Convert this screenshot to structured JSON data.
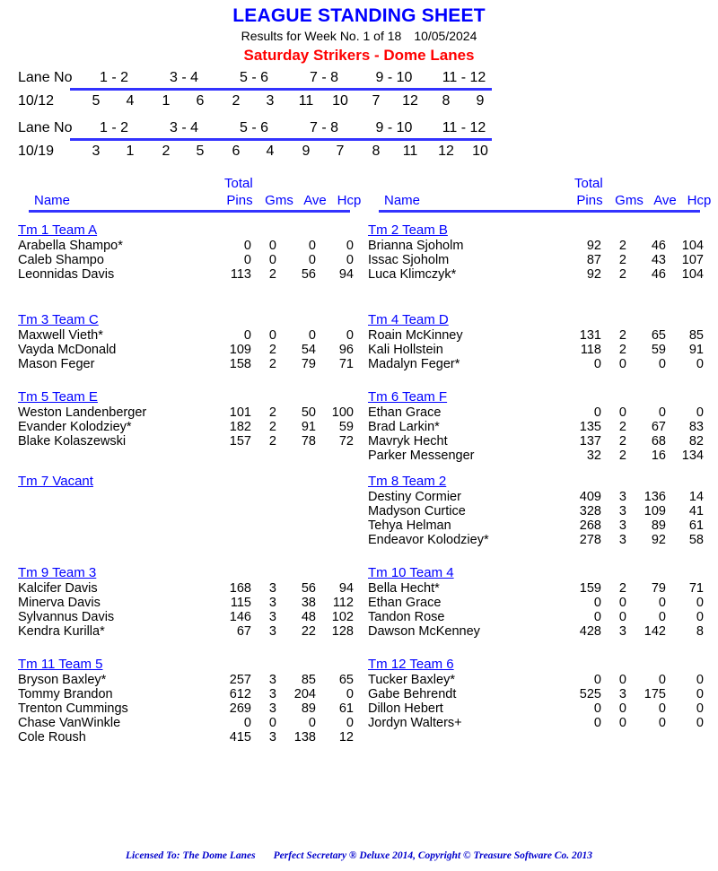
{
  "colors": {
    "title_blue": "#0000ff",
    "league_red": "#ff0000",
    "rule_blue": "#3333ff",
    "footer_blue": "#0000cc",
    "text_black": "#000000"
  },
  "header": {
    "title": "LEAGUE STANDING SHEET",
    "results_prefix": "Results for Week No. 1 of 18",
    "results_date": "10/05/2024",
    "league_name": "Saturday Strikers - Dome Lanes"
  },
  "lane_schedule": {
    "label": "Lane No",
    "pair_headers": [
      "1 - 2",
      "3 - 4",
      "5 - 6",
      "7 - 8",
      "9 - 10",
      "11 - 12"
    ],
    "weeks": [
      {
        "date": "10/12",
        "pairs": [
          [
            "5",
            "4"
          ],
          [
            "1",
            "6"
          ],
          [
            "2",
            "3"
          ],
          [
            "11",
            "10"
          ],
          [
            "7",
            "12"
          ],
          [
            "8",
            "9"
          ]
        ]
      },
      {
        "date": "10/19",
        "pairs": [
          [
            "3",
            "1"
          ],
          [
            "2",
            "5"
          ],
          [
            "6",
            "4"
          ],
          [
            "9",
            "7"
          ],
          [
            "8",
            "11"
          ],
          [
            "12",
            "10"
          ]
        ]
      }
    ]
  },
  "table_header": {
    "name": "Name",
    "total": "Total",
    "pins": "Pins",
    "gms": "Gms",
    "ave": "Ave",
    "hcp": "Hcp"
  },
  "columns": {
    "left": [
      {
        "team": "Tm 1 Team A",
        "players": [
          {
            "name": "Arabella Shampo*",
            "pins": "0",
            "gms": "0",
            "ave": "0",
            "hcp": "0"
          },
          {
            "name": "Caleb Shampo",
            "pins": "0",
            "gms": "0",
            "ave": "0",
            "hcp": "0"
          },
          {
            "name": "Leonnidas Davis",
            "pins": "113",
            "gms": "2",
            "ave": "56",
            "hcp": "94"
          }
        ]
      },
      {
        "team": "Tm 3 Team C",
        "players": [
          {
            "name": "Maxwell Vieth*",
            "pins": "0",
            "gms": "0",
            "ave": "0",
            "hcp": "0"
          },
          {
            "name": "Vayda McDonald",
            "pins": "109",
            "gms": "2",
            "ave": "54",
            "hcp": "96"
          },
          {
            "name": "Mason Feger",
            "pins": "158",
            "gms": "2",
            "ave": "79",
            "hcp": "71"
          }
        ]
      },
      {
        "team": "Tm 5 Team E",
        "players": [
          {
            "name": "Weston Landenberger",
            "pins": "101",
            "gms": "2",
            "ave": "50",
            "hcp": "100"
          },
          {
            "name": "Evander Kolodziey*",
            "pins": "182",
            "gms": "2",
            "ave": "91",
            "hcp": "59"
          },
          {
            "name": "Blake Kolaszewski",
            "pins": "157",
            "gms": "2",
            "ave": "78",
            "hcp": "72"
          }
        ]
      },
      {
        "team": "Tm 7 Vacant",
        "players": []
      },
      {
        "team": "Tm 9 Team 3",
        "players": [
          {
            "name": "Kalcifer Davis",
            "pins": "168",
            "gms": "3",
            "ave": "56",
            "hcp": "94"
          },
          {
            "name": "Minerva Davis",
            "pins": "115",
            "gms": "3",
            "ave": "38",
            "hcp": "112"
          },
          {
            "name": "Sylvannus Davis",
            "pins": "146",
            "gms": "3",
            "ave": "48",
            "hcp": "102"
          },
          {
            "name": "Kendra Kurilla*",
            "pins": "67",
            "gms": "3",
            "ave": "22",
            "hcp": "128"
          }
        ]
      },
      {
        "team": "Tm 11 Team 5",
        "players": [
          {
            "name": "Bryson Baxley*",
            "pins": "257",
            "gms": "3",
            "ave": "85",
            "hcp": "65"
          },
          {
            "name": "Tommy Brandon",
            "pins": "612",
            "gms": "3",
            "ave": "204",
            "hcp": "0"
          },
          {
            "name": "Trenton Cummings",
            "pins": "269",
            "gms": "3",
            "ave": "89",
            "hcp": "61"
          },
          {
            "name": "Chase VanWinkle",
            "pins": "0",
            "gms": "0",
            "ave": "0",
            "hcp": "0"
          },
          {
            "name": "Cole Roush",
            "pins": "415",
            "gms": "3",
            "ave": "138",
            "hcp": "12"
          }
        ]
      }
    ],
    "right": [
      {
        "team": "Tm 2 Team B",
        "players": [
          {
            "name": "Brianna Sjoholm",
            "pins": "92",
            "gms": "2",
            "ave": "46",
            "hcp": "104"
          },
          {
            "name": "Issac Sjoholm",
            "pins": "87",
            "gms": "2",
            "ave": "43",
            "hcp": "107"
          },
          {
            "name": "Luca Klimczyk*",
            "pins": "92",
            "gms": "2",
            "ave": "46",
            "hcp": "104"
          }
        ]
      },
      {
        "team": "Tm 4 Team D",
        "players": [
          {
            "name": "Roain McKinney",
            "pins": "131",
            "gms": "2",
            "ave": "65",
            "hcp": "85"
          },
          {
            "name": "Kali Hollstein",
            "pins": "118",
            "gms": "2",
            "ave": "59",
            "hcp": "91"
          },
          {
            "name": "Madalyn Feger*",
            "pins": "0",
            "gms": "0",
            "ave": "0",
            "hcp": "0"
          }
        ]
      },
      {
        "team": "Tm 6 Team F",
        "players": [
          {
            "name": "Ethan Grace",
            "pins": "0",
            "gms": "0",
            "ave": "0",
            "hcp": "0"
          },
          {
            "name": "Brad Larkin*",
            "pins": "135",
            "gms": "2",
            "ave": "67",
            "hcp": "83"
          },
          {
            "name": "Mavryk Hecht",
            "pins": "137",
            "gms": "2",
            "ave": "68",
            "hcp": "82"
          },
          {
            "name": "Parker Messenger",
            "pins": "32",
            "gms": "2",
            "ave": "16",
            "hcp": "134"
          }
        ]
      },
      {
        "team": "Tm 8 Team 2",
        "players": [
          {
            "name": "Destiny Cormier",
            "pins": "409",
            "gms": "3",
            "ave": "136",
            "hcp": "14"
          },
          {
            "name": "Madyson Curtice",
            "pins": "328",
            "gms": "3",
            "ave": "109",
            "hcp": "41"
          },
          {
            "name": "Tehya Helman",
            "pins": "268",
            "gms": "3",
            "ave": "89",
            "hcp": "61"
          },
          {
            "name": "Endeavor Kolodziey*",
            "pins": "278",
            "gms": "3",
            "ave": "92",
            "hcp": "58"
          }
        ]
      },
      {
        "team": "Tm 10 Team 4",
        "players": [
          {
            "name": "Bella Hecht*",
            "pins": "159",
            "gms": "2",
            "ave": "79",
            "hcp": "71"
          },
          {
            "name": "Ethan Grace",
            "pins": "0",
            "gms": "0",
            "ave": "0",
            "hcp": "0"
          },
          {
            "name": "Tandon Rose",
            "pins": "0",
            "gms": "0",
            "ave": "0",
            "hcp": "0"
          },
          {
            "name": "Dawson McKenney",
            "pins": "428",
            "gms": "3",
            "ave": "142",
            "hcp": "8"
          }
        ]
      },
      {
        "team": "Tm 12 Team 6",
        "players": [
          {
            "name": "Tucker Baxley*",
            "pins": "0",
            "gms": "0",
            "ave": "0",
            "hcp": "0"
          },
          {
            "name": "Gabe Behrendt",
            "pins": "525",
            "gms": "3",
            "ave": "175",
            "hcp": "0"
          },
          {
            "name": "Dillon Hebert",
            "pins": "0",
            "gms": "0",
            "ave": "0",
            "hcp": "0"
          },
          {
            "name": "Jordyn Walters+",
            "pins": "0",
            "gms": "0",
            "ave": "0",
            "hcp": "0"
          }
        ]
      }
    ]
  },
  "block_tops": [
    52,
    152,
    238,
    332,
    434,
    536
  ],
  "footer": {
    "licensed_to": "Licensed To: The Dome Lanes",
    "copyright": "Perfect Secretary ® Deluxe  2014, Copyright © Treasure Software Co. 2013"
  }
}
